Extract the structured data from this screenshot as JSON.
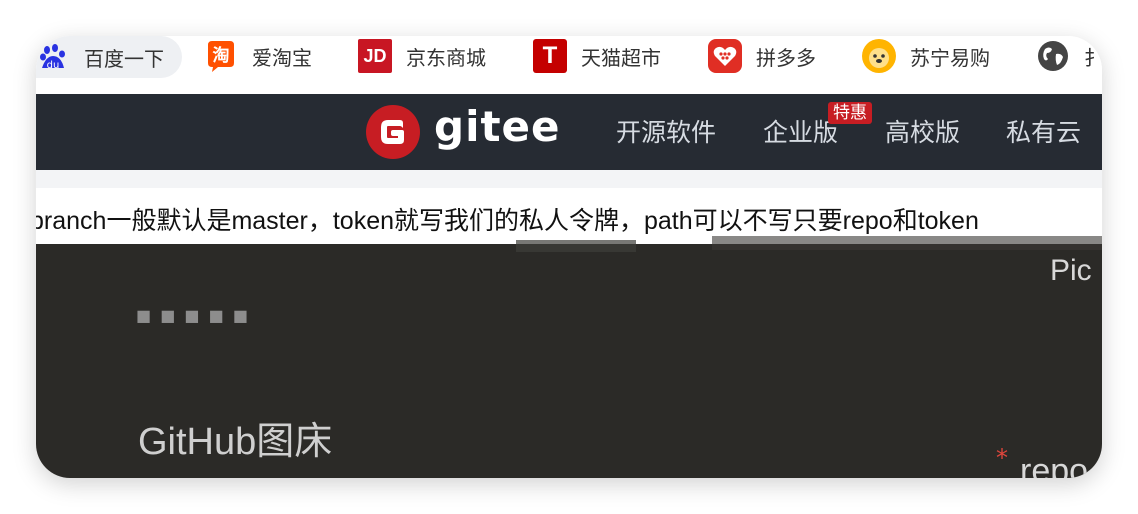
{
  "bookmarks": [
    {
      "label": "百度一下",
      "icon": "baidu-icon"
    },
    {
      "label": "爱淘宝",
      "icon": "taobao-icon"
    },
    {
      "label": "京东商城",
      "icon": "jd-icon",
      "icon_text": "JD"
    },
    {
      "label": "天猫超市",
      "icon": "tmall-icon",
      "icon_text": "T"
    },
    {
      "label": "拼多多",
      "icon": "pinduoduo-icon"
    },
    {
      "label": "苏宁易购",
      "icon": "suning-icon"
    },
    {
      "label": "扌",
      "icon": "globe-icon"
    }
  ],
  "gitee": {
    "logo_text": "gitee",
    "nav": [
      "开源软件",
      "企业版",
      "高校版",
      "私有云"
    ],
    "badge": "特惠"
  },
  "content": {
    "instruction": "branch一般默认是master，token就写我们的私人令牌，path可以不写只要repo和token",
    "pic_label": "Pic",
    "dots": "■ ■ ■ ■ ■",
    "section_title": "GitHub图床",
    "required_mark": "*",
    "repo_label": "repo"
  },
  "colors": {
    "gitee_header": "#262b33",
    "gitee_red": "#c71d23",
    "dark_panel": "#2b2a27"
  }
}
